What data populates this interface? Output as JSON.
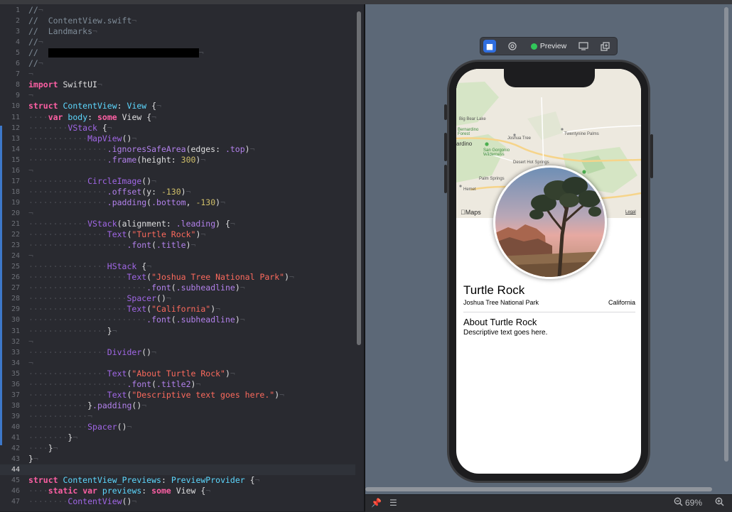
{
  "editor": {
    "file_name": "ContentView.swift",
    "current_line": 44,
    "lines": [
      {
        "n": "1",
        "segs": [
          [
            "cm",
            "//"
          ],
          [
            "ws",
            "¬"
          ]
        ]
      },
      {
        "n": "2",
        "segs": [
          [
            "cm",
            "//  ContentView.swift"
          ],
          [
            "ws",
            "¬"
          ]
        ]
      },
      {
        "n": "3",
        "segs": [
          [
            "cm",
            "//  Landmarks"
          ],
          [
            "ws",
            "¬"
          ]
        ]
      },
      {
        "n": "4",
        "segs": [
          [
            "cm",
            "//"
          ],
          [
            "ws",
            "¬"
          ]
        ]
      },
      {
        "n": "5",
        "segs": [
          [
            "cm",
            "//  "
          ],
          [
            "redact",
            ""
          ],
          [
            "ws",
            "¬"
          ]
        ]
      },
      {
        "n": "6",
        "segs": [
          [
            "cm",
            "//"
          ],
          [
            "ws",
            "¬"
          ]
        ]
      },
      {
        "n": "7",
        "segs": [
          [
            "ws",
            "¬"
          ]
        ]
      },
      {
        "n": "8",
        "segs": [
          [
            "kw",
            "import"
          ],
          [
            "pl",
            " SwiftUI"
          ],
          [
            "ws",
            "¬"
          ]
        ]
      },
      {
        "n": "9",
        "segs": [
          [
            "ws",
            "¬"
          ]
        ]
      },
      {
        "n": "10",
        "segs": [
          [
            "kw",
            "struct"
          ],
          [
            "pl",
            " "
          ],
          [
            "ty",
            "ContentView"
          ],
          [
            "pl",
            ": "
          ],
          [
            "ty",
            "View"
          ],
          [
            "pl",
            " {"
          ],
          [
            "ws",
            "¬"
          ]
        ]
      },
      {
        "n": "11",
        "segs": [
          [
            "ws",
            "····"
          ],
          [
            "kw",
            "var"
          ],
          [
            "pl",
            " "
          ],
          [
            "ty",
            "body"
          ],
          [
            "pl",
            ": "
          ],
          [
            "kw",
            "some"
          ],
          [
            "pl",
            " View {"
          ],
          [
            "ws",
            "¬"
          ]
        ]
      },
      {
        "n": "12",
        "segs": [
          [
            "ws",
            "········"
          ],
          [
            "fn",
            "VStack"
          ],
          [
            "pl",
            " {"
          ],
          [
            "ws",
            "¬"
          ]
        ]
      },
      {
        "n": "13",
        "segs": [
          [
            "ws",
            "············"
          ],
          [
            "fn",
            "MapView"
          ],
          [
            "pl",
            "()"
          ],
          [
            "ws",
            "¬"
          ]
        ]
      },
      {
        "n": "14",
        "segs": [
          [
            "ws",
            "················"
          ],
          [
            "mt",
            ".ignoresSafeArea"
          ],
          [
            "pl",
            "(edges: "
          ],
          [
            "mt",
            ".top"
          ],
          [
            "pl",
            ")"
          ],
          [
            "ws",
            "¬"
          ]
        ]
      },
      {
        "n": "15",
        "segs": [
          [
            "ws",
            "················"
          ],
          [
            "mt",
            ".frame"
          ],
          [
            "pl",
            "(height: "
          ],
          [
            "num",
            "300"
          ],
          [
            "pl",
            ")"
          ],
          [
            "ws",
            "¬"
          ]
        ]
      },
      {
        "n": "16",
        "segs": [
          [
            "ws",
            "¬"
          ]
        ]
      },
      {
        "n": "17",
        "segs": [
          [
            "ws",
            "············"
          ],
          [
            "fn",
            "CircleImage"
          ],
          [
            "pl",
            "()"
          ],
          [
            "ws",
            "¬"
          ]
        ]
      },
      {
        "n": "18",
        "segs": [
          [
            "ws",
            "················"
          ],
          [
            "mt",
            ".offset"
          ],
          [
            "pl",
            "(y: "
          ],
          [
            "num",
            "-130"
          ],
          [
            "pl",
            ")"
          ],
          [
            "ws",
            "¬"
          ]
        ]
      },
      {
        "n": "19",
        "segs": [
          [
            "ws",
            "················"
          ],
          [
            "mt",
            ".padding"
          ],
          [
            "pl",
            "("
          ],
          [
            "mt",
            ".bottom"
          ],
          [
            "pl",
            ", "
          ],
          [
            "num",
            "-130"
          ],
          [
            "pl",
            ")"
          ],
          [
            "ws",
            "¬"
          ]
        ]
      },
      {
        "n": "20",
        "segs": [
          [
            "ws",
            "¬"
          ]
        ]
      },
      {
        "n": "21",
        "segs": [
          [
            "ws",
            "············"
          ],
          [
            "fn",
            "VStack"
          ],
          [
            "pl",
            "(alignment: "
          ],
          [
            "mt",
            ".leading"
          ],
          [
            "pl",
            ") {"
          ],
          [
            "ws",
            "¬"
          ]
        ]
      },
      {
        "n": "22",
        "segs": [
          [
            "ws",
            "················"
          ],
          [
            "fn",
            "Text"
          ],
          [
            "pl",
            "("
          ],
          [
            "str",
            "\"Turtle Rock\""
          ],
          [
            "pl",
            ")"
          ],
          [
            "ws",
            "¬"
          ]
        ]
      },
      {
        "n": "23",
        "segs": [
          [
            "ws",
            "····················"
          ],
          [
            "mt",
            ".font"
          ],
          [
            "pl",
            "("
          ],
          [
            "mt",
            ".title"
          ],
          [
            "pl",
            ")"
          ],
          [
            "ws",
            "¬"
          ]
        ]
      },
      {
        "n": "24",
        "segs": [
          [
            "ws",
            "¬"
          ]
        ]
      },
      {
        "n": "25",
        "segs": [
          [
            "ws",
            "················"
          ],
          [
            "fn",
            "HStack"
          ],
          [
            "pl",
            " {"
          ],
          [
            "ws",
            "¬"
          ]
        ]
      },
      {
        "n": "26",
        "segs": [
          [
            "ws",
            "····················"
          ],
          [
            "fn",
            "Text"
          ],
          [
            "pl",
            "("
          ],
          [
            "str",
            "\"Joshua Tree National Park\""
          ],
          [
            "pl",
            ")"
          ],
          [
            "ws",
            "¬"
          ]
        ]
      },
      {
        "n": "27",
        "segs": [
          [
            "ws",
            "························"
          ],
          [
            "mt",
            ".font"
          ],
          [
            "pl",
            "("
          ],
          [
            "mt",
            ".subheadline"
          ],
          [
            "pl",
            ")"
          ],
          [
            "ws",
            "¬"
          ]
        ]
      },
      {
        "n": "28",
        "segs": [
          [
            "ws",
            "····················"
          ],
          [
            "fn",
            "Spacer"
          ],
          [
            "pl",
            "()"
          ],
          [
            "ws",
            "¬"
          ]
        ]
      },
      {
        "n": "29",
        "segs": [
          [
            "ws",
            "····················"
          ],
          [
            "fn",
            "Text"
          ],
          [
            "pl",
            "("
          ],
          [
            "str",
            "\"California\""
          ],
          [
            "pl",
            ")"
          ],
          [
            "ws",
            "¬"
          ]
        ]
      },
      {
        "n": "30",
        "segs": [
          [
            "ws",
            "························"
          ],
          [
            "mt",
            ".font"
          ],
          [
            "pl",
            "("
          ],
          [
            "mt",
            ".subheadline"
          ],
          [
            "pl",
            ")"
          ],
          [
            "ws",
            "¬"
          ]
        ]
      },
      {
        "n": "31",
        "segs": [
          [
            "ws",
            "················"
          ],
          [
            "pl",
            "}"
          ],
          [
            "ws",
            "¬"
          ]
        ]
      },
      {
        "n": "32",
        "segs": [
          [
            "ws",
            "¬"
          ]
        ]
      },
      {
        "n": "33",
        "segs": [
          [
            "ws",
            "················"
          ],
          [
            "fn",
            "Divider"
          ],
          [
            "pl",
            "()"
          ],
          [
            "ws",
            "¬"
          ]
        ]
      },
      {
        "n": "34",
        "segs": [
          [
            "ws",
            "¬"
          ]
        ]
      },
      {
        "n": "35",
        "segs": [
          [
            "ws",
            "················"
          ],
          [
            "fn",
            "Text"
          ],
          [
            "pl",
            "("
          ],
          [
            "str",
            "\"About Turtle Rock\""
          ],
          [
            "pl",
            ")"
          ],
          [
            "ws",
            "¬"
          ]
        ]
      },
      {
        "n": "36",
        "segs": [
          [
            "ws",
            "····················"
          ],
          [
            "mt",
            ".font"
          ],
          [
            "pl",
            "("
          ],
          [
            "mt",
            ".title2"
          ],
          [
            "pl",
            ")"
          ],
          [
            "ws",
            "¬"
          ]
        ]
      },
      {
        "n": "37",
        "segs": [
          [
            "ws",
            "················"
          ],
          [
            "fn",
            "Text"
          ],
          [
            "pl",
            "("
          ],
          [
            "str",
            "\"Descriptive text goes here.\""
          ],
          [
            "pl",
            ")"
          ],
          [
            "ws",
            "¬"
          ]
        ]
      },
      {
        "n": "38",
        "segs": [
          [
            "ws",
            "············"
          ],
          [
            "pl",
            "}"
          ],
          [
            "mt",
            ".padding"
          ],
          [
            "pl",
            "()"
          ],
          [
            "ws",
            "¬"
          ]
        ]
      },
      {
        "n": "39",
        "segs": [
          [
            "ws",
            "············¬"
          ]
        ]
      },
      {
        "n": "40",
        "segs": [
          [
            "ws",
            "············"
          ],
          [
            "fn",
            "Spacer"
          ],
          [
            "pl",
            "()"
          ],
          [
            "ws",
            "¬"
          ]
        ]
      },
      {
        "n": "41",
        "segs": [
          [
            "ws",
            "········"
          ],
          [
            "pl",
            "}"
          ],
          [
            "ws",
            "¬"
          ]
        ]
      },
      {
        "n": "42",
        "segs": [
          [
            "ws",
            "····"
          ],
          [
            "pl",
            "}"
          ],
          [
            "ws",
            "¬"
          ]
        ]
      },
      {
        "n": "43",
        "segs": [
          [
            "pl",
            "}"
          ],
          [
            "ws",
            "¬"
          ]
        ]
      },
      {
        "n": "44",
        "segs": []
      },
      {
        "n": "45",
        "segs": [
          [
            "kw",
            "struct"
          ],
          [
            "pl",
            " "
          ],
          [
            "ty",
            "ContentView_Previews"
          ],
          [
            "pl",
            ": "
          ],
          [
            "ty",
            "PreviewProvider"
          ],
          [
            "pl",
            " {"
          ],
          [
            "ws",
            "¬"
          ]
        ]
      },
      {
        "n": "46",
        "segs": [
          [
            "ws",
            "····"
          ],
          [
            "kw",
            "static"
          ],
          [
            "pl",
            " "
          ],
          [
            "kw",
            "var"
          ],
          [
            "pl",
            " "
          ],
          [
            "ty",
            "previews"
          ],
          [
            "pl",
            ": "
          ],
          [
            "kw",
            "some"
          ],
          [
            "pl",
            " View {"
          ],
          [
            "ws",
            "¬"
          ]
        ]
      },
      {
        "n": "47",
        "segs": [
          [
            "ws",
            "········"
          ],
          [
            "fn",
            "ContentView"
          ],
          [
            "pl",
            "()"
          ],
          [
            "ws",
            "¬"
          ]
        ]
      }
    ]
  },
  "canvas_toolbar": {
    "preview_label": "Preview",
    "live_icon": "play-icon",
    "inspect_icon": "inspect-icon",
    "device_icon": "device-settings-icon",
    "duplicate_icon": "duplicate-preview-icon"
  },
  "preview": {
    "map": {
      "attribution": "Maps",
      "legal": "Legal",
      "places": [
        "Big Bear Lake",
        "Bernardino Forest",
        "Joshua Tree",
        "Twentynine Palms",
        "ardino",
        "San Gorgonio Wilderness",
        "Desert Hot Springs",
        "Palm Springs",
        "Hemet"
      ]
    },
    "title": "Turtle Rock",
    "park": "Joshua Tree National Park",
    "state": "California",
    "about_title": "About Turtle Rock",
    "description": "Descriptive text goes here."
  },
  "statusbar": {
    "zoom": "69%",
    "pin_icon": "pin-icon",
    "list_icon": "list-icon",
    "zoom_out_icon": "zoom-out-icon",
    "zoom_in_icon": "zoom-in-icon"
  },
  "colors": {
    "editor_bg": "#292a30",
    "keyword": "#fc5fa3",
    "type": "#5dd8ff",
    "function": "#a167e6",
    "string": "#fc6a5d",
    "number": "#d0bf69",
    "canvas_bg": "#5c6877",
    "accent": "#2f6ee0",
    "live_dot": "#31c75a"
  }
}
